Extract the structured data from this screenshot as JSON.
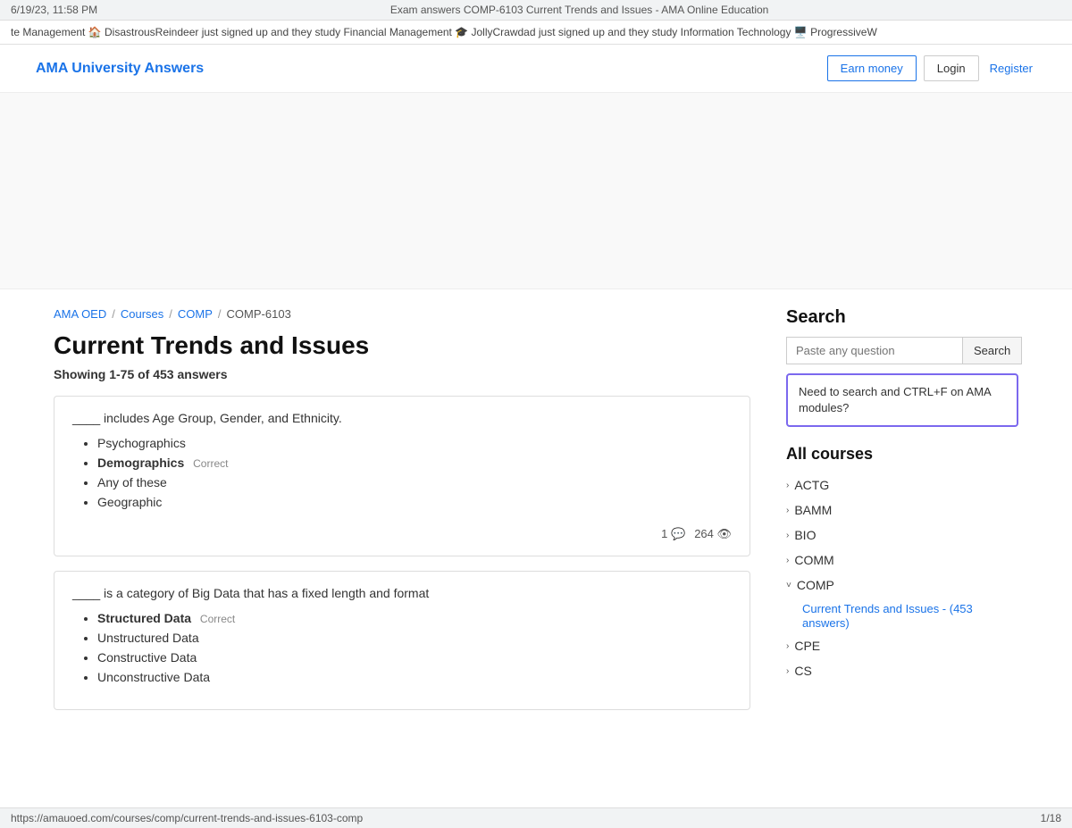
{
  "browser": {
    "timestamp": "6/19/23, 11:58 PM",
    "title": "Exam answers COMP-6103 Current Trends and Issues - AMA Online Education",
    "pagination": "1/18"
  },
  "notification_bar": {
    "text": "te Management 🏠  DisastrousReindeer just signed up and they study Financial Management 🎓  JollyCrawdad just signed up and they study Information Technology 🖥️  ProgressiveW"
  },
  "header": {
    "logo": "AMA University Answers",
    "earn_money": "Earn money",
    "login": "Login",
    "register": "Register"
  },
  "breadcrumb": {
    "items": [
      {
        "label": "AMA OED",
        "href": "#"
      },
      {
        "label": "Courses",
        "href": "#"
      },
      {
        "label": "COMP",
        "href": "#"
      },
      {
        "label": "COMP-6103",
        "href": "#"
      }
    ]
  },
  "page": {
    "title": "Current Trends and Issues",
    "showing": "Showing 1-75 of 453 answers"
  },
  "questions": [
    {
      "id": 1,
      "question": "____ includes Age Group, Gender, and Ethnicity.",
      "answers": [
        {
          "text": "Psychographics",
          "correct": false
        },
        {
          "text": "Demographics",
          "correct": true
        },
        {
          "text": "Any of these",
          "correct": false
        },
        {
          "text": "Geographic",
          "correct": false
        }
      ],
      "comments": 1,
      "views": 264
    },
    {
      "id": 2,
      "question": "____ is a category of Big Data that has a fixed length and format",
      "answers": [
        {
          "text": "Structured Data",
          "correct": true
        },
        {
          "text": "Unstructured Data",
          "correct": false
        },
        {
          "text": "Constructive Data",
          "correct": false
        },
        {
          "text": "Unconstructive Data",
          "correct": false
        }
      ],
      "comments": null,
      "views": null
    }
  ],
  "sidebar": {
    "search_title": "Search",
    "search_placeholder": "Paste any question",
    "search_button": "Search",
    "search_hint": "Need to search and CTRL+F on AMA modules?",
    "all_courses_title": "All courses",
    "courses": [
      {
        "code": "ACTG",
        "expanded": false,
        "children": []
      },
      {
        "code": "BAMM",
        "expanded": false,
        "children": []
      },
      {
        "code": "BIO",
        "expanded": false,
        "children": []
      },
      {
        "code": "COMM",
        "expanded": false,
        "children": []
      },
      {
        "code": "COMP",
        "expanded": true,
        "children": [
          {
            "label": "Current Trends and Issues - (453 answers)",
            "href": "#"
          }
        ]
      },
      {
        "code": "CPE",
        "expanded": false,
        "children": []
      },
      {
        "code": "CS",
        "expanded": false,
        "children": []
      }
    ]
  },
  "footer": {
    "url": "https://amauoed.com/courses/comp/current-trends-and-issues-6103-comp",
    "pagination": "1/18"
  },
  "labels": {
    "correct": "Correct"
  }
}
